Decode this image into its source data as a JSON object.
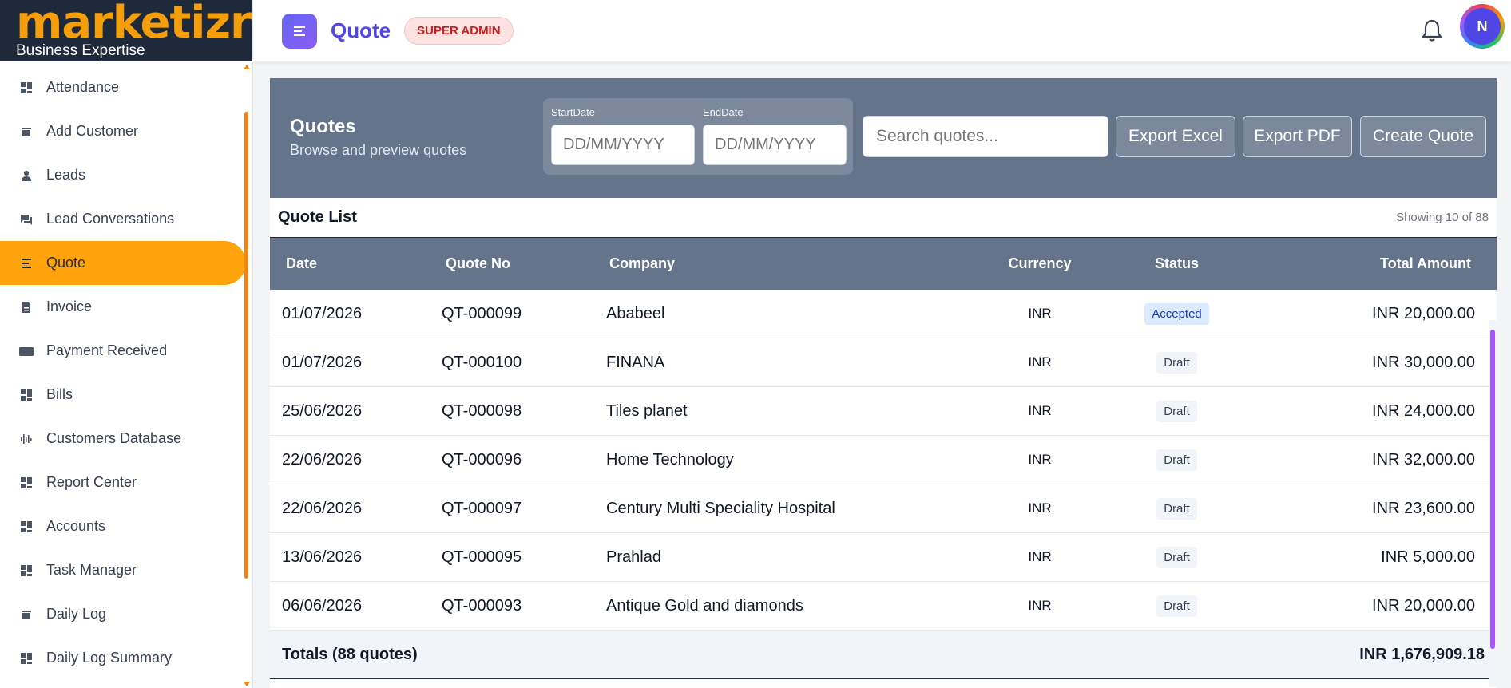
{
  "brand": {
    "logo": "marketizr",
    "tagline": "Business Expertise"
  },
  "sidebar": {
    "items": [
      {
        "label": "Attendance",
        "icon": "grid-icon",
        "active": false
      },
      {
        "label": "Add Customer",
        "icon": "tray-icon",
        "active": false
      },
      {
        "label": "Leads",
        "icon": "person-icon",
        "active": false
      },
      {
        "label": "Lead Conversations",
        "icon": "chat-icon",
        "active": false
      },
      {
        "label": "Quote",
        "icon": "list-icon",
        "active": true
      },
      {
        "label": "Invoice",
        "icon": "document-icon",
        "active": false
      },
      {
        "label": "Payment Received",
        "icon": "card-icon",
        "active": false
      },
      {
        "label": "Bills",
        "icon": "grid-icon",
        "active": false
      },
      {
        "label": "Customers Database",
        "icon": "bars-icon",
        "active": false
      },
      {
        "label": "Report Center",
        "icon": "grid-icon",
        "active": false
      },
      {
        "label": "Accounts",
        "icon": "grid-icon",
        "active": false
      },
      {
        "label": "Task Manager",
        "icon": "grid-icon",
        "active": false
      },
      {
        "label": "Daily Log",
        "icon": "tray-icon",
        "active": false
      },
      {
        "label": "Daily Log Summary",
        "icon": "grid-icon",
        "active": false
      }
    ]
  },
  "topbar": {
    "title": "Quote",
    "role": "SUPER ADMIN",
    "avatar_initial": "N"
  },
  "quotes_panel": {
    "title": "Quotes",
    "subtitle": "Browse and preview quotes",
    "start_label": "StartDate",
    "end_label": "EndDate",
    "start_placeholder": "DD/MM/YYYY",
    "end_placeholder": "DD/MM/YYYY",
    "search_placeholder": "Search quotes...",
    "export_excel": "Export Excel",
    "export_pdf": "Export PDF",
    "create_quote": "Create Quote"
  },
  "list": {
    "title": "Quote List",
    "showing": "Showing 10 of 88",
    "columns": {
      "date": "Date",
      "quote_no": "Quote No",
      "company": "Company",
      "currency": "Currency",
      "status": "Status",
      "total": "Total Amount"
    },
    "rows": [
      {
        "date": "01/07/2026",
        "quote_no": "QT-000099",
        "company": "Ababeel",
        "currency": "INR",
        "status": "Accepted",
        "total": "INR 20,000.00"
      },
      {
        "date": "01/07/2026",
        "quote_no": "QT-000100",
        "company": "FINANA",
        "currency": "INR",
        "status": "Draft",
        "total": "INR 30,000.00"
      },
      {
        "date": "25/06/2026",
        "quote_no": "QT-000098",
        "company": "Tiles planet",
        "currency": "INR",
        "status": "Draft",
        "total": "INR 24,000.00"
      },
      {
        "date": "22/06/2026",
        "quote_no": "QT-000096",
        "company": "Home Technology",
        "currency": "INR",
        "status": "Draft",
        "total": "INR 32,000.00"
      },
      {
        "date": "22/06/2026",
        "quote_no": "QT-000097",
        "company": "Century Multi Speciality Hospital",
        "currency": "INR",
        "status": "Draft",
        "total": "INR 23,600.00"
      },
      {
        "date": "13/06/2026",
        "quote_no": "QT-000095",
        "company": "Prahlad",
        "currency": "INR",
        "status": "Draft",
        "total": "INR 5,000.00"
      },
      {
        "date": "06/06/2026",
        "quote_no": "QT-000093",
        "company": "Antique Gold and diamonds",
        "currency": "INR",
        "status": "Draft",
        "total": "INR 20,000.00"
      }
    ],
    "totals_label": "Totals (88 quotes)",
    "totals_value": "INR 1,676,909.18"
  },
  "colors": {
    "accent": "#ffa40c",
    "header": "#64748b",
    "brand_bg": "#1e293b",
    "title": "#4f46e5"
  }
}
